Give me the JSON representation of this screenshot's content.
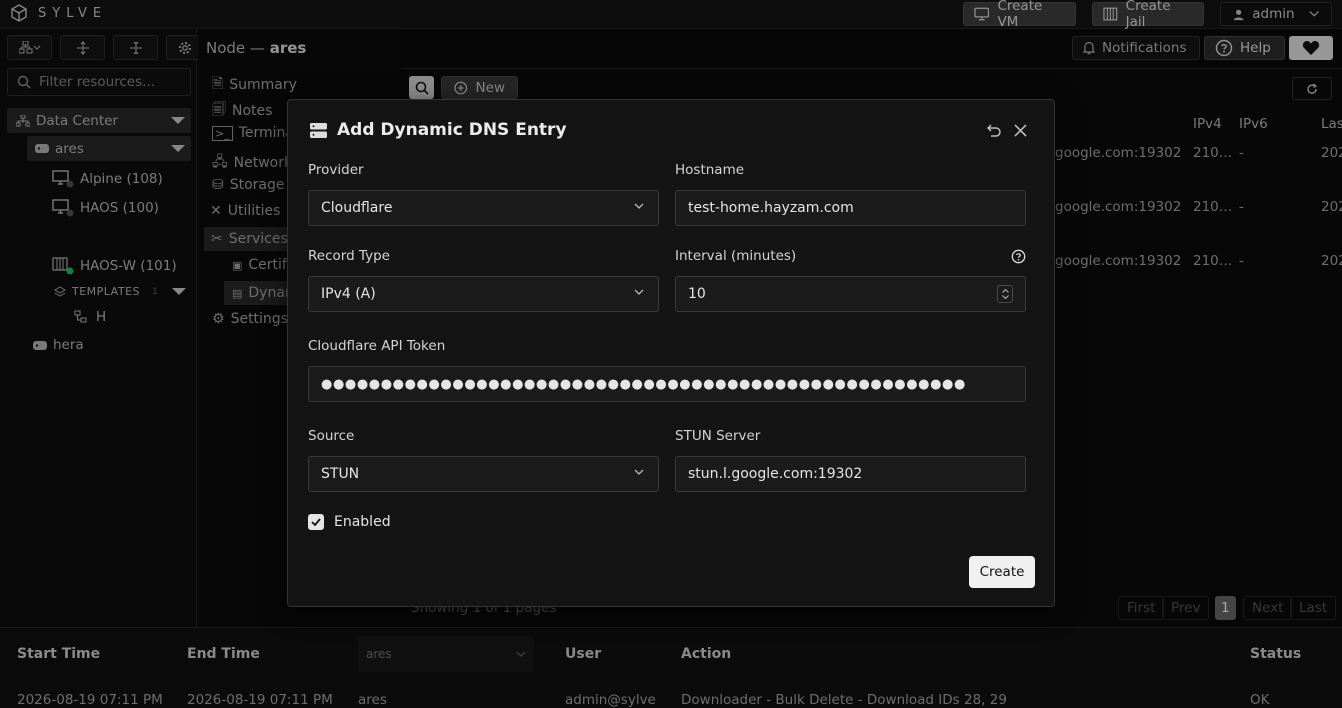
{
  "app": {
    "name": "SYLVE"
  },
  "topbar": {
    "create_vm": "Create VM",
    "create_jail": "Create Jail",
    "user": "admin"
  },
  "sidebar": {
    "filter_placeholder": "Filter resources...",
    "tree": {
      "datacenter": "Data Center",
      "node": "ares",
      "vms": [
        "Alpine (108)",
        "HAOS (100)",
        "HAOS-W (101)"
      ],
      "templates_label": "TEMPLATES",
      "templates_count": "1",
      "template_item": "H",
      "other_node": "hera"
    }
  },
  "header": {
    "node_prefix": "Node —",
    "node_name": "ares",
    "notifications": "Notifications",
    "help": "Help"
  },
  "nav": {
    "items": [
      "Summary",
      "Notes",
      "Terminal",
      "Network",
      "Storage",
      "Utilities",
      "Services",
      "Settings"
    ],
    "sub_items": [
      "Certif",
      "Dynar"
    ]
  },
  "content": {
    "new_label": "New",
    "columns": {
      "ipv4": "IPv4",
      "ipv6": "IPv6",
      "last": "Las"
    },
    "rows": [
      {
        "stun": "google.com:19302",
        "ipv4": "210…",
        "ipv6": "-",
        "last": "202"
      },
      {
        "stun": "google.com:19302",
        "ipv4": "210…",
        "ipv6": "-",
        "last": "202"
      },
      {
        "stun": "google.com:19302",
        "ipv4": "210…",
        "ipv6": "-",
        "last": "202"
      }
    ],
    "showing": "Showing 1 of 1 pages",
    "pager": {
      "first": "First",
      "prev": "Prev",
      "page": "1",
      "next": "Next",
      "last": "Last"
    }
  },
  "modal": {
    "title": "Add Dynamic DNS Entry",
    "provider_label": "Provider",
    "provider_value": "Cloudflare",
    "hostname_label": "Hostname",
    "hostname_value": "test-home.hayzam.com",
    "record_type_label": "Record Type",
    "record_type_value": "IPv4 (A)",
    "interval_label": "Interval (minutes)",
    "interval_value": "10",
    "token_label": "Cloudflare API Token",
    "token_value": "●●●●●●●●●●●●●●●●●●●●●●●●●●●●●●●●●●●●●●●●●●●●●●●●●●●●●●",
    "source_label": "Source",
    "source_value": "STUN",
    "stun_label": "STUN Server",
    "stun_value": "stun.l.google.com:19302",
    "enabled_label": "Enabled",
    "enabled": true,
    "create_label": "Create"
  },
  "logs": {
    "columns": {
      "start": "Start Time",
      "end": "End Time",
      "node_filter": "ares",
      "user": "User",
      "action": "Action",
      "status": "Status"
    },
    "row": {
      "start": "2026-08-19 07:11 PM",
      "end": "2026-08-19 07:11 PM",
      "node": "ares",
      "user": "admin@sylve",
      "action": "Downloader - Bulk Delete - Download IDs 28, 29",
      "status": "OK"
    }
  }
}
